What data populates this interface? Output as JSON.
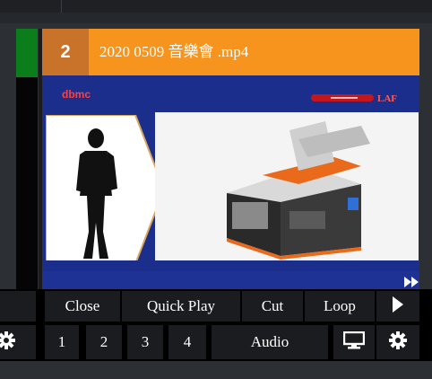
{
  "card": {
    "number": "2",
    "title": "2020 0509 音樂會 .mp4",
    "thumbnail": {
      "brand_left": "dbmc",
      "brand_right": "LAF"
    }
  },
  "controls": {
    "close_label": "Close",
    "quick_play_label": "Quick Play",
    "cut_label": "Cut",
    "loop_label": "Loop",
    "play_icon": "play-icon",
    "output_1": "1",
    "output_2": "2",
    "output_3": "3",
    "output_4": "4",
    "audio_label": "Audio",
    "monitor_icon": "monitor-icon",
    "settings_icon": "gear-icon"
  },
  "colors": {
    "header_orange": "#f7941d",
    "number_block": "#c8722a",
    "left_tab_green": "#0b7d1a",
    "thumb_blue": "#1b2e8c"
  }
}
